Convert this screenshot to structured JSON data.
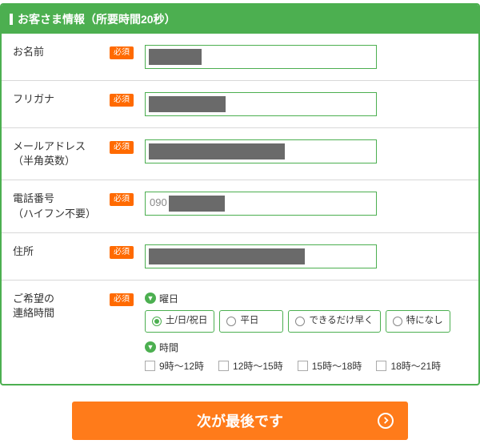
{
  "header": {
    "title": "お客さま情報（所要時間20秒）"
  },
  "badges": {
    "required": "必須"
  },
  "fields": {
    "name": {
      "label": "お名前",
      "value": ""
    },
    "furigana": {
      "label": "フリガナ",
      "value": ""
    },
    "email": {
      "label": "メールアドレス",
      "sub": "（半角英数）",
      "value": ""
    },
    "phone": {
      "label": "電話番号",
      "sub": "（ハイフン不要）",
      "value": "",
      "prefix_hint": "090"
    },
    "address": {
      "label": "住所",
      "value": ""
    },
    "contact": {
      "label": "ご希望の",
      "sub": "連絡時間"
    }
  },
  "contact": {
    "day_section_label": "曜日",
    "day_options": [
      {
        "label": "土/日/祝日",
        "selected": true
      },
      {
        "label": "平日",
        "selected": false
      },
      {
        "label": "できるだけ早く",
        "selected": false
      },
      {
        "label": "特になし",
        "selected": false
      }
    ],
    "time_section_label": "時間",
    "time_options": [
      {
        "label": "9時～12時",
        "checked": false
      },
      {
        "label": "12時～15時",
        "checked": false
      },
      {
        "label": "15時～18時",
        "checked": false
      },
      {
        "label": "18時～21時",
        "checked": false
      }
    ]
  },
  "submit": {
    "label": "次が最後です"
  }
}
